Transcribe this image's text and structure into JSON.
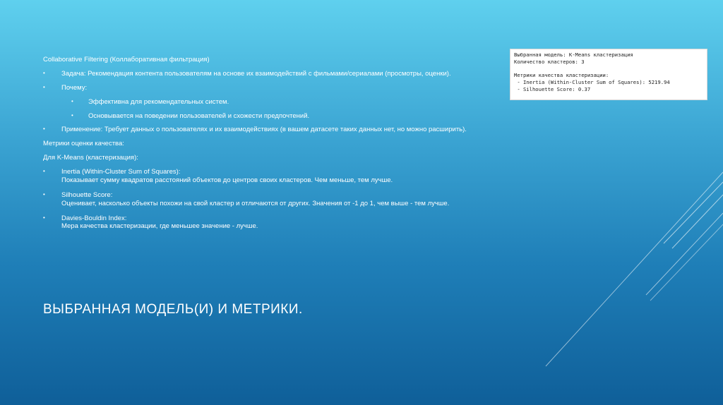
{
  "content": {
    "cf_heading": "Collaborative Filtering (Коллаборативная фильтрация)",
    "task": "Задача: Рекомендация контента пользователям на основе их взаимодействий с фильмами/сериалами (просмотры, оценки).",
    "why": "Почему:",
    "why_items": [
      "Эффективна для рекомендательных систем.",
      "Основывается на поведении пользователей и схожести предпочтений."
    ],
    "application": "Применение: Требует данных о пользователях и их взаимодействиях (в вашем датасете таких данных нет, но можно расширить).",
    "metrics_heading": "Метрики оценки качества:",
    "kmeans_heading": "Для K-Means (кластеризация):",
    "metrics": [
      {
        "name": "Inertia (Within-Cluster Sum of Squares):",
        "desc": "Показывает сумму квадратов расстояний объектов до центров своих кластеров. Чем меньше, тем лучше."
      },
      {
        "name": "Silhouette Score:",
        "desc": "Оценивает, насколько объекты похожи на свой кластер и отличаются от других. Значения от -1 до 1, чем выше - тем лучше."
      },
      {
        "name": "Davies-Bouldin Index:",
        "desc": "Мера качества кластеризации, где меньшее значение - лучше."
      }
    ]
  },
  "title": "ВЫБРАННАЯ МОДЕЛЬ(И) И МЕТРИКИ.",
  "snippet": {
    "line1": "Выбранная модель: K-Means кластеризация",
    "line2": "Количество кластеров: 3",
    "line3": "",
    "line4": "Метрики качества кластеризации:",
    "line5": " - Inertia (Within-Cluster Sum of Squares): 5219.94",
    "line6": " - Silhouette Score: 0.37"
  },
  "colors": {
    "background_top": "#5fd0ee",
    "background_bottom": "#0f5f99",
    "text": "#ffffff"
  }
}
